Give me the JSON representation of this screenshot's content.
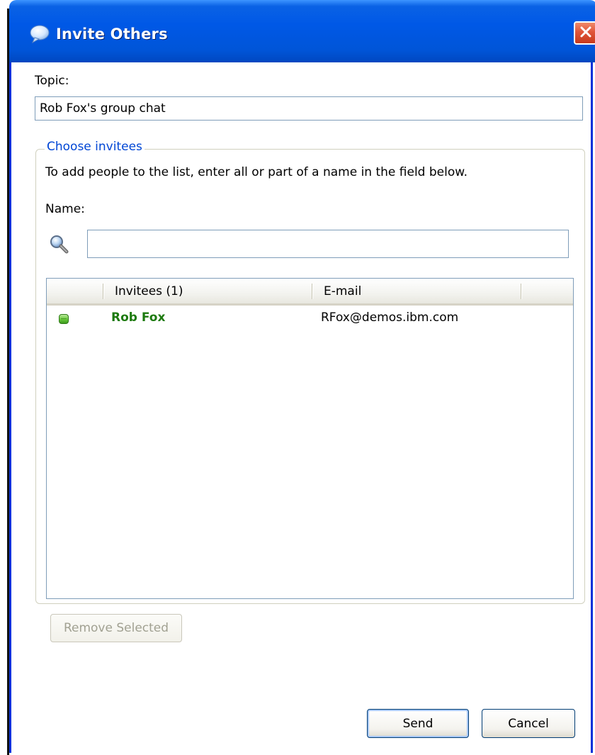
{
  "window": {
    "title": "Invite Others",
    "close_icon": "close-icon",
    "title_icon": "chat-bubble-icon"
  },
  "topic": {
    "label": "Topic:",
    "value": "Rob Fox's group chat"
  },
  "invitees_group": {
    "legend": "Choose invitees",
    "instructions": "To add people to the list, enter all or part of a name in the field below.",
    "name_label": "Name:",
    "name_value": "",
    "search_icon": "magnifier-icon"
  },
  "invitee_list": {
    "columns": [
      "",
      "Invitees (1)",
      "E-mail"
    ],
    "rows": [
      {
        "status": "available",
        "status_icon": "online-status-icon",
        "name": "Rob Fox",
        "email": "RFox@demos.ibm.com"
      }
    ]
  },
  "buttons": {
    "remove_selected": "Remove Selected",
    "send": "Send",
    "cancel": "Cancel"
  },
  "colors": {
    "title_bar": "#0058e6",
    "legend_text": "#0046d5",
    "online_name": "#1d7a0f",
    "close_button": "#e0553a"
  }
}
